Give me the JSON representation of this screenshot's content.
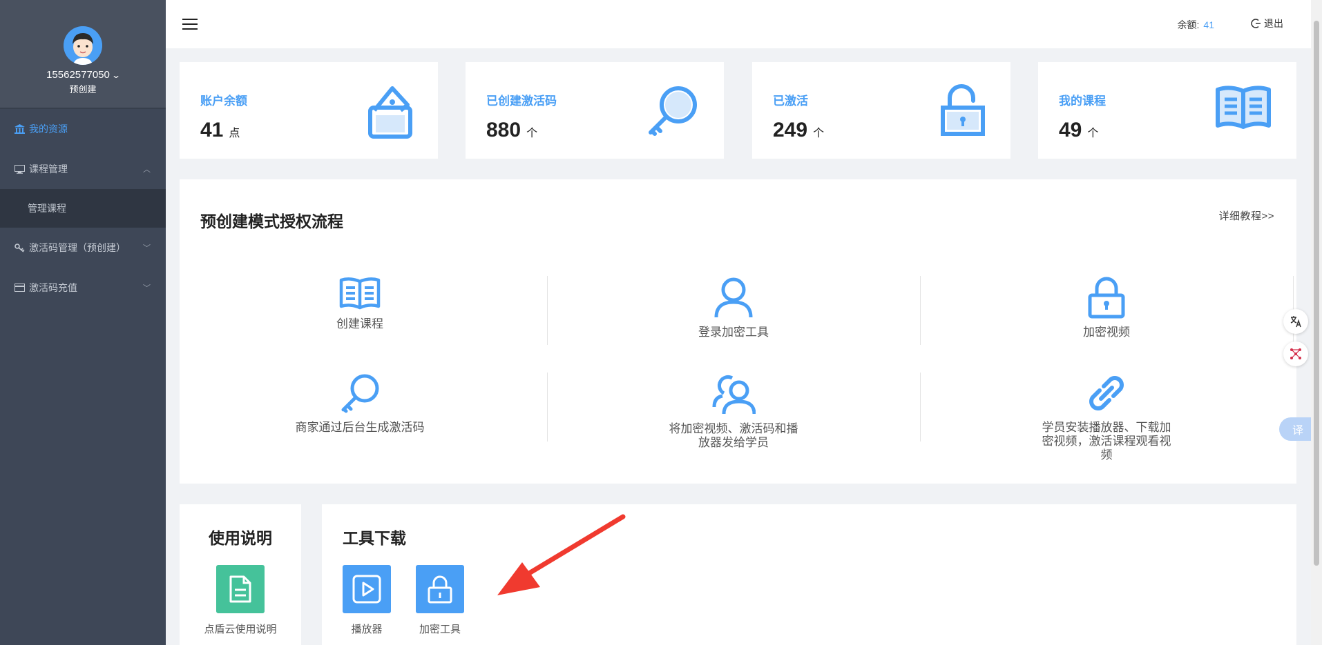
{
  "sidebar": {
    "username": "15562577050",
    "role": "预创建",
    "items": [
      {
        "label": "我的资源"
      },
      {
        "label": "课程管理"
      },
      {
        "label": "管理课程"
      },
      {
        "label": "激活码管理（预创建）"
      },
      {
        "label": "激活码充值"
      }
    ]
  },
  "header": {
    "balance_label": "余额:",
    "balance_value": "41",
    "logout_label": "退出"
  },
  "stats": [
    {
      "title": "账户余额",
      "value": "41",
      "unit": "点",
      "icon": "wallet-icon"
    },
    {
      "title": "已创建激活码",
      "value": "880",
      "unit": "个",
      "icon": "key-icon"
    },
    {
      "title": "已激活",
      "value": "249",
      "unit": "个",
      "icon": "unlock-icon"
    },
    {
      "title": "我的课程",
      "value": "49",
      "unit": "个",
      "icon": "book-icon"
    }
  ],
  "flow": {
    "title": "预创建模式授权流程",
    "detail_link": "详细教程>>",
    "steps": [
      {
        "label": "创建课程",
        "icon": "book-icon"
      },
      {
        "label": "登录加密工具",
        "icon": "user-icon"
      },
      {
        "label": "加密视频",
        "icon": "lock-icon"
      },
      {
        "label": "商家通过后台生成激活码",
        "icon": "key-icon"
      },
      {
        "label": "将加密视频、激活码和播放器发给学员",
        "icon": "users-icon"
      },
      {
        "label": "学员安装播放器、下载加密视频，激活课程观看视频",
        "icon": "link-icon"
      }
    ]
  },
  "usage": {
    "title": "使用说明",
    "doc_label": "点盾云使用说明"
  },
  "tools": {
    "title": "工具下载",
    "items": [
      {
        "label": "播放器",
        "icon": "play-icon"
      },
      {
        "label": "加密工具",
        "icon": "lock-icon"
      }
    ]
  },
  "float": {
    "translate_label": "译"
  },
  "colors": {
    "accent": "#4a9ff5",
    "sidebar": "#3e4757",
    "doc_tile": "#45c29a",
    "arrow": "#f03a2f"
  }
}
